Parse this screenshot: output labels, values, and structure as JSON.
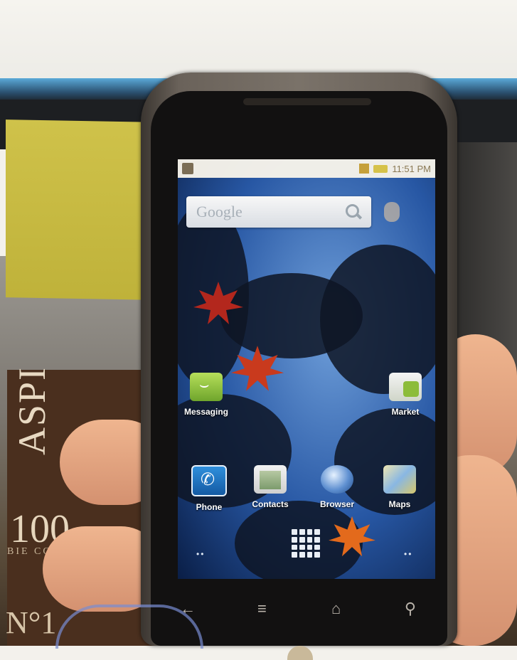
{
  "status_bar": {
    "time": "11:51 PM"
  },
  "search_widget": {
    "logo": "Google"
  },
  "apps": [
    {
      "label": "Messaging",
      "icon": "messaging-icon"
    },
    {
      "label": "Market",
      "icon": "market-icon"
    },
    {
      "label": "Phone",
      "icon": "phone-icon"
    },
    {
      "label": "Contacts",
      "icon": "contacts-icon"
    },
    {
      "label": "Browser",
      "icon": "browser-icon"
    },
    {
      "label": "Maps",
      "icon": "maps-icon"
    }
  ],
  "nav_buttons": [
    "back-icon",
    "menu-icon",
    "home-icon",
    "search-icon"
  ],
  "packaging": {
    "big_letters": "ASPI",
    "number": "100",
    "sub": "BIE CONTI",
    "n1": "N°1"
  },
  "colors": {
    "wallpaper_sky": "#4f86cf",
    "leaf_red": "#b3271d",
    "leaf_orange": "#e36a1c"
  }
}
